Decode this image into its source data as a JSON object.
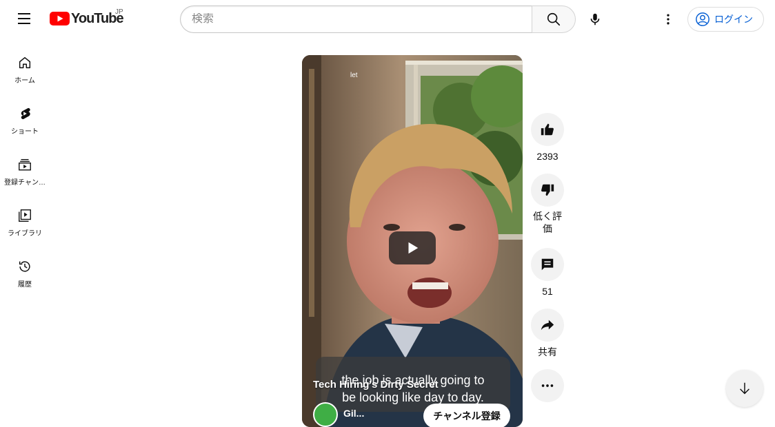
{
  "header": {
    "logo_text": "YouTube",
    "country_code": "JP",
    "search_placeholder": "検索",
    "login_label": "ログイン"
  },
  "sidebar": {
    "items": [
      {
        "label": "ホーム",
        "icon": "home-icon"
      },
      {
        "label": "ショート",
        "icon": "shorts-icon"
      },
      {
        "label": "登録チャン…",
        "icon": "subscriptions-icon"
      },
      {
        "label": "ライブラリ",
        "icon": "library-icon"
      },
      {
        "label": "履歴",
        "icon": "history-icon"
      }
    ]
  },
  "short": {
    "title": "Tech Hiring's Dirty Secret",
    "caption_line1": "the job is actually going to",
    "caption_line2": "be looking like day to day.",
    "top_label": "let",
    "channel_name": "Gil...",
    "subscribe_label": "チャンネル登録"
  },
  "actions": {
    "like_count": "2393",
    "dislike_label": "低く評\n価",
    "dislike_line1": "低く評",
    "dislike_line2": "価",
    "comment_count": "51",
    "share_label": "共有"
  },
  "colors": {
    "brand_red": "#ff0000",
    "link_blue": "#065fd4",
    "button_gray": "#f2f2f2"
  }
}
